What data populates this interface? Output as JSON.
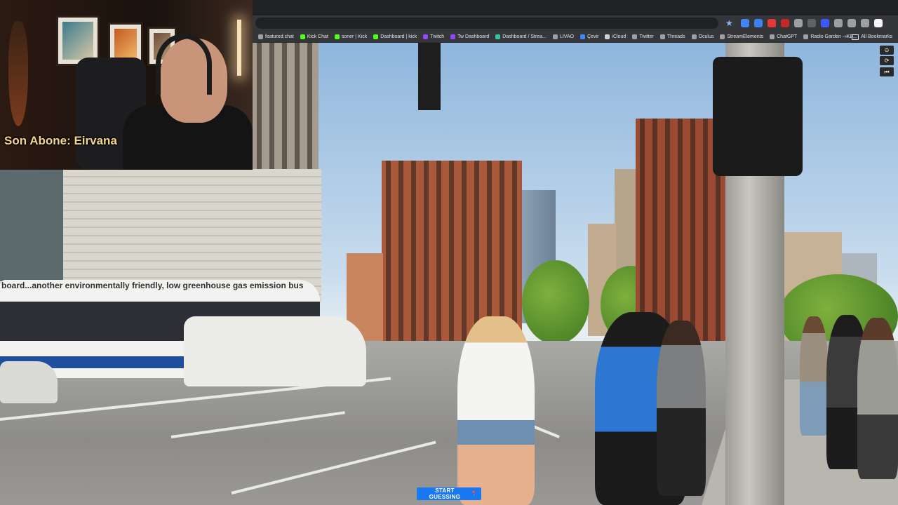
{
  "browser": {
    "bookmarks": [
      {
        "label": "featured.chat",
        "icon": "bookmark-icon",
        "color": "#9aa0a6"
      },
      {
        "label": "Kick Chat",
        "icon": "kick-icon",
        "color": "#53fc18"
      },
      {
        "label": "soner | Kick",
        "icon": "kick-icon",
        "color": "#53fc18"
      },
      {
        "label": "Dashboard | kick",
        "icon": "kick-icon",
        "color": "#53fc18"
      },
      {
        "label": "Twitch",
        "icon": "twitch-icon",
        "color": "#9146ff"
      },
      {
        "label": "Tw Dashboard",
        "icon": "twitch-icon",
        "color": "#9146ff"
      },
      {
        "label": "Dashboard / Strea...",
        "icon": "dashboard-icon",
        "color": "#31c3a2"
      },
      {
        "label": "LIVAO",
        "icon": "globe-icon",
        "color": "#9aa0a6"
      },
      {
        "label": "Çevir",
        "icon": "translate-icon",
        "color": "#4285f4"
      },
      {
        "label": "iCloud",
        "icon": "apple-icon",
        "color": "#cfcfcf"
      },
      {
        "label": "Twitter",
        "icon": "globe-icon",
        "color": "#9aa0a6"
      },
      {
        "label": "Threads",
        "icon": "globe-icon",
        "color": "#9aa0a6"
      },
      {
        "label": "Oculus",
        "icon": "globe-icon",
        "color": "#9aa0a6"
      },
      {
        "label": "StreamElements",
        "icon": "globe-icon",
        "color": "#9aa0a6"
      },
      {
        "label": "ChatGPT",
        "icon": "chatgpt-icon",
        "color": "#9aa0a6"
      },
      {
        "label": "Radio Garden – KB...",
        "icon": "globe-icon",
        "color": "#9aa0a6"
      }
    ],
    "more_bookmarks": "»",
    "all_bookmarks": "All Bookmarks",
    "star": "★",
    "extension_colors": [
      "#4285f4",
      "#3b82f6",
      "#e53935",
      "#c62828",
      "#9aa0a6",
      "#5f6368",
      "#3d5afe",
      "#9aa0a6",
      "#9aa0a6",
      "#9aa0a6",
      "#f5f5f5"
    ]
  },
  "webcam": {
    "label": "Son Abone: Eirvana"
  },
  "scene": {
    "bus_ad": "board...another environmentally friendly, low greenhouse gas emission bus"
  },
  "controls": {
    "compass": "⊙",
    "refresh": "⟳",
    "back_to_start": "⏮"
  },
  "guess_button": {
    "label": "START GUESSING",
    "icon": "📍"
  }
}
